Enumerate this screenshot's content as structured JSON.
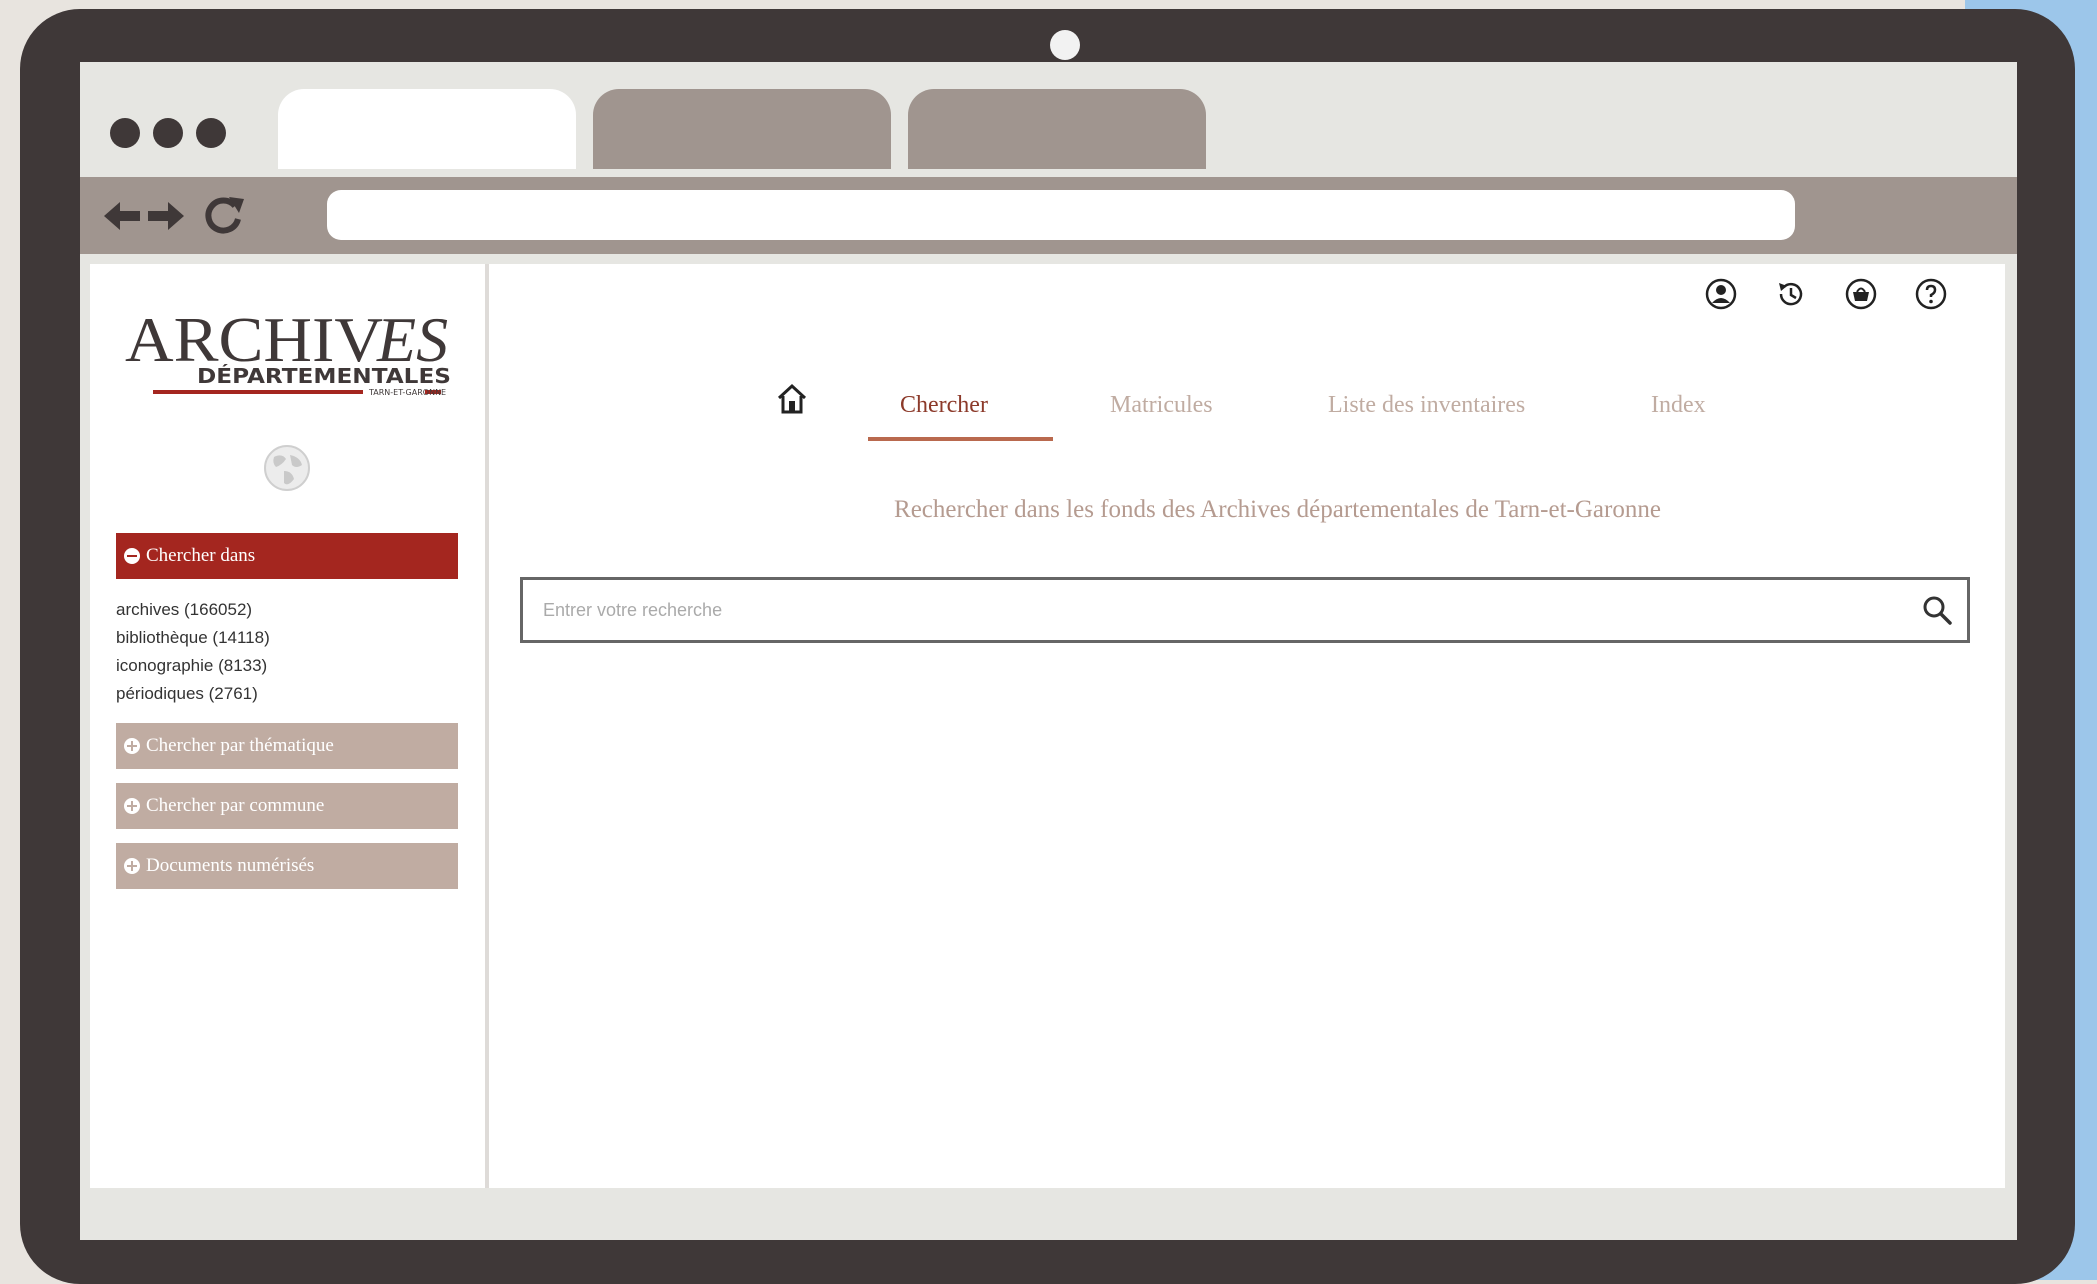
{
  "browser": {
    "tabs": [
      "",
      "",
      ""
    ],
    "url": ""
  },
  "header_icons": [
    "user-icon",
    "history-icon",
    "basket-icon",
    "help-icon"
  ],
  "sidebar": {
    "search_in_label": "Chercher dans",
    "fonds": [
      "archives (166052)",
      "bibliothèque (14118)",
      "iconographie (8133)",
      "périodiques (2761)"
    ],
    "buttons": [
      "Chercher par thématique",
      "Chercher par commune",
      "Documents numérisés"
    ]
  },
  "nav": {
    "tabs": [
      "Chercher",
      "Matricules",
      "Liste des inventaires",
      "Index"
    ],
    "active_tab": "Chercher"
  },
  "main": {
    "subtitle": "Rechercher dans les fonds des Archives départementales de Tarn-et-Garonne",
    "search_placeholder": "Entrer votre recherche"
  },
  "colors": {
    "accent": "#a4261f",
    "inactive_button": "#c0aca2",
    "device_frame": "#3f3838"
  }
}
